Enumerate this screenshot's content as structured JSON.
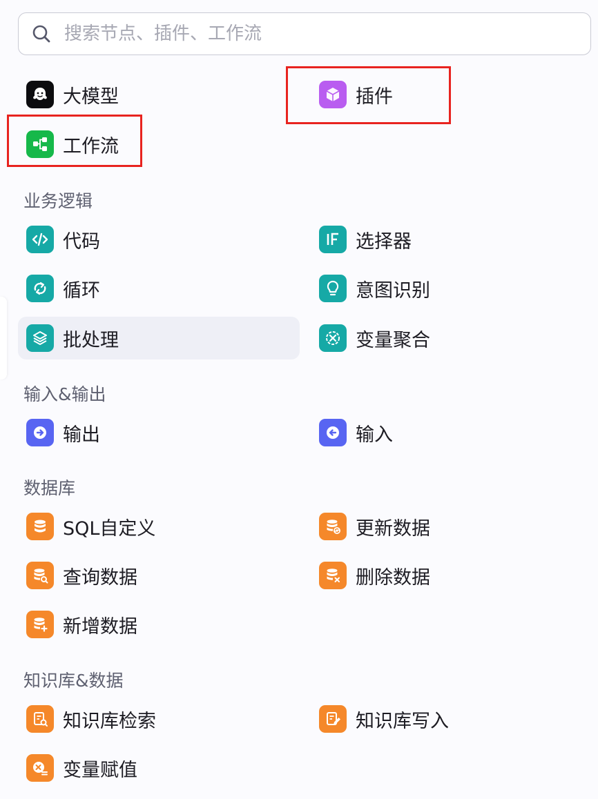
{
  "search": {
    "placeholder": "搜索节点、插件、工作流",
    "value": "",
    "icon": "search-icon"
  },
  "top_items": [
    {
      "label": "大模型",
      "icon": "llm-icon",
      "color": "#0c0c0f"
    },
    {
      "label": "插件",
      "icon": "plugin-cube-icon",
      "color": "#b95df0"
    },
    {
      "label": "工作流",
      "icon": "workflow-icon",
      "color": "#16b84a"
    }
  ],
  "sections": [
    {
      "title": "业务逻辑",
      "items": [
        {
          "label": "代码",
          "icon": "code-icon",
          "color": "#16a9a6"
        },
        {
          "label": "选择器",
          "icon": "if-icon",
          "color": "#16a9a6"
        },
        {
          "label": "循环",
          "icon": "loop-icon",
          "color": "#16a9a6"
        },
        {
          "label": "意图识别",
          "icon": "intent-icon",
          "color": "#16a9a6"
        },
        {
          "label": "批处理",
          "icon": "batch-icon",
          "color": "#16a9a6"
        },
        {
          "label": "变量聚合",
          "icon": "variable-merge-icon",
          "color": "#16a9a6"
        }
      ]
    },
    {
      "title": "输入&输出",
      "items": [
        {
          "label": "输出",
          "icon": "output-icon",
          "color": "#5865f2"
        },
        {
          "label": "输入",
          "icon": "input-icon",
          "color": "#5865f2"
        }
      ]
    },
    {
      "title": "数据库",
      "items": [
        {
          "label": "SQL自定义",
          "icon": "database-icon",
          "color": "#f5882a"
        },
        {
          "label": "更新数据",
          "icon": "database-update-icon",
          "color": "#f5882a"
        },
        {
          "label": "查询数据",
          "icon": "database-search-icon",
          "color": "#f5882a"
        },
        {
          "label": "删除数据",
          "icon": "database-delete-icon",
          "color": "#f5882a"
        },
        {
          "label": "新增数据",
          "icon": "database-add-icon",
          "color": "#f5882a"
        }
      ]
    },
    {
      "title": "知识库&数据",
      "items": [
        {
          "label": "知识库检索",
          "icon": "knowledge-search-icon",
          "color": "#f5882a"
        },
        {
          "label": "知识库写入",
          "icon": "knowledge-write-icon",
          "color": "#f5882a"
        },
        {
          "label": "变量赋值",
          "icon": "variable-assign-icon",
          "color": "#f5882a"
        }
      ]
    }
  ],
  "highlight_color": "#e8231f",
  "hovered_item": "批处理"
}
